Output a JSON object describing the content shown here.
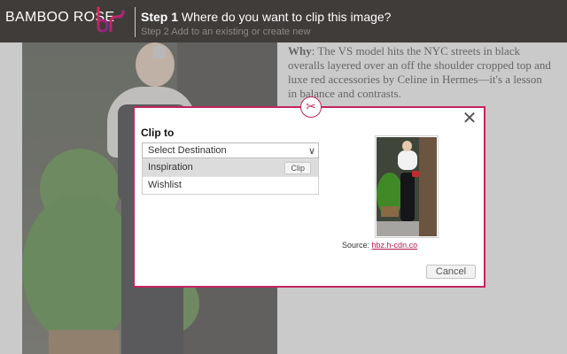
{
  "background_page": {
    "article": {
      "label": "Why",
      "text": ": The VS model hits the NYC streets in black overalls layered over an off the shoulder cropped top and luxe red accessories by Celine in Hermes—it's a lesson in balance and contrasts."
    }
  },
  "header": {
    "brand": "BAMBOO ROSE",
    "step1_label": "Step 1",
    "step1_text": "Where do you want to clip this image?",
    "step2_label": "Step 2",
    "step2_text": "Add to an existing or create new",
    "close_icon": "✕"
  },
  "modal": {
    "badge_icon": "✂",
    "close_icon": "✕",
    "clip_to_label": "Clip to",
    "select": {
      "placeholder": "Select Destination",
      "chevron": "∨"
    },
    "destinations": [
      {
        "label": "Inspiration",
        "action": "Clip"
      },
      {
        "label": "Wishlist"
      }
    ],
    "source_label": "Source:",
    "source_link": "hbz.h-cdn.co",
    "cancel_label": "Cancel"
  },
  "colors": {
    "accent": "#c3245f",
    "header_bg": "#3f3c3a"
  }
}
